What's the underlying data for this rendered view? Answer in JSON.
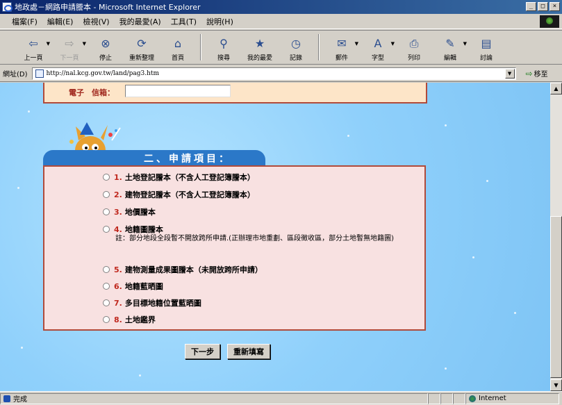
{
  "window": {
    "title": "地政處－網路申請謄本 - Microsoft Internet Explorer",
    "buttons": {
      "minimize": "_",
      "maximize": "□",
      "close": "×"
    }
  },
  "menu": [
    "檔案(F)",
    "編輯(E)",
    "檢視(V)",
    "我的最愛(A)",
    "工具(T)",
    "說明(H)"
  ],
  "toolbar": {
    "back": "上一頁",
    "forward": "下一頁",
    "stop": "停止",
    "refresh": "重新整理",
    "home": "首頁",
    "search": "搜尋",
    "favorites": "我的最愛",
    "history": "記錄",
    "mail": "郵件",
    "font": "字型",
    "print": "列印",
    "edit": "編輯",
    "discuss": "討論"
  },
  "address": {
    "label": "網址(D)",
    "url": "http://nal.kcg.gov.tw/land/pag3.htm",
    "go": "移至"
  },
  "form": {
    "email_label": "電子　信箱：",
    "email_value": "",
    "section_title": "二、申請項目：",
    "options": [
      {
        "num": "1.",
        "label": "土地登記謄本（不含人工登記簿謄本）"
      },
      {
        "num": "2.",
        "label": "建物登記謄本（不含人工登記簿謄本）"
      },
      {
        "num": "3.",
        "label": "地價謄本"
      },
      {
        "num": "4.",
        "label": "地籍圖謄本"
      },
      {
        "num": "5.",
        "label": "建物測量成果圖謄本（未開放跨所申請）"
      },
      {
        "num": "6.",
        "label": "地籍藍晒圖"
      },
      {
        "num": "7.",
        "label": "多目標地籍位置藍晒圖"
      },
      {
        "num": "8.",
        "label": "土地鑑界"
      }
    ],
    "note": "註：部分地段全段暫不開放跨所申請.(正辦理市地重劃、區段徵收區，部分土地暫無地籍圖)",
    "next_button": "下一步",
    "reset_button": "重新填寫"
  },
  "status": {
    "left": "完成",
    "zone": "Internet"
  }
}
